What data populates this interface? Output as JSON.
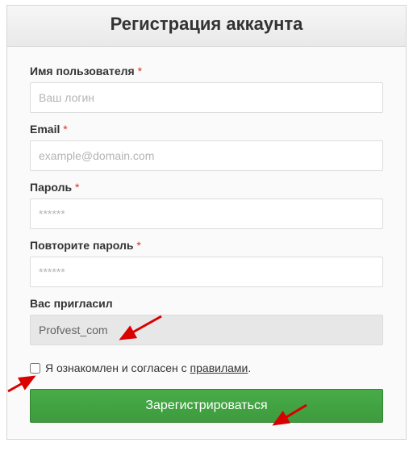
{
  "header": {
    "title": "Регистрация аккаунта"
  },
  "fields": {
    "username": {
      "label": "Имя пользователя",
      "required": "*",
      "placeholder": "Ваш логин",
      "value": ""
    },
    "email": {
      "label": "Email",
      "required": "*",
      "placeholder": "example@domain.com",
      "value": ""
    },
    "password": {
      "label": "Пароль",
      "required": "*",
      "placeholder": "******",
      "value": ""
    },
    "password2": {
      "label": "Повторите пароль",
      "required": "*",
      "placeholder": "******",
      "value": ""
    },
    "referrer": {
      "label": "Вас пригласил",
      "value": "Profvest_com"
    }
  },
  "agreement": {
    "prefix": "Я ознакомлен и согласен с ",
    "link": "правилами",
    "suffix": "."
  },
  "submit": {
    "label": "Зарегистрироваться"
  },
  "annotations": {
    "arrow_color": "#d90000"
  }
}
